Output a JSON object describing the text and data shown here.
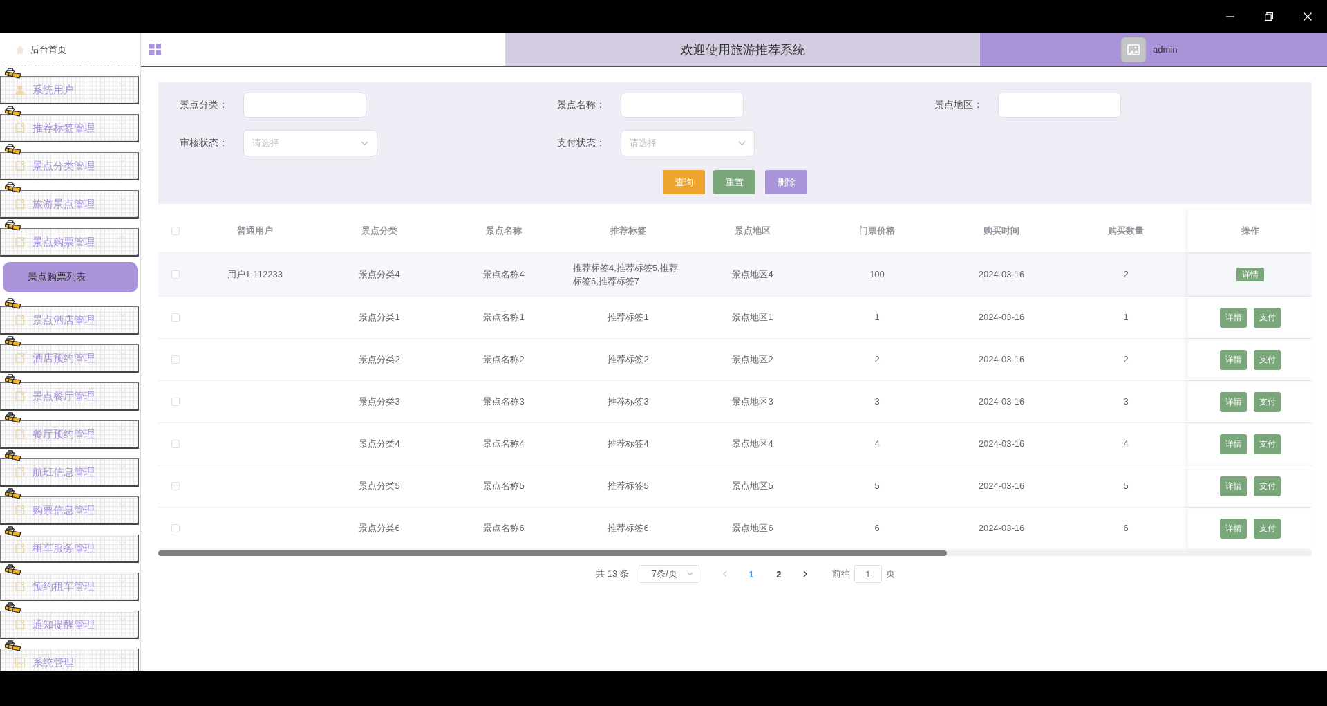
{
  "sidebar": {
    "home": {
      "label": "后台首页"
    },
    "items": [
      {
        "label": "系统用户",
        "kind": "user",
        "expanded": false
      },
      {
        "label": "推荐标签管理",
        "kind": "doc",
        "expanded": false
      },
      {
        "label": "景点分类管理",
        "kind": "doc",
        "expanded": false
      },
      {
        "label": "旅游景点管理",
        "kind": "doc",
        "expanded": false
      },
      {
        "label": "景点购票管理",
        "kind": "doc",
        "expanded": true,
        "children": [
          {
            "label": "景点购票列表",
            "selected": true
          }
        ]
      },
      {
        "label": "景点酒店管理",
        "kind": "doc",
        "expanded": false
      },
      {
        "label": "酒店预约管理",
        "kind": "doc",
        "expanded": false
      },
      {
        "label": "景点餐厅管理",
        "kind": "doc",
        "expanded": false
      },
      {
        "label": "餐厅预约管理",
        "kind": "doc",
        "expanded": false
      },
      {
        "label": "航班信息管理",
        "kind": "doc",
        "expanded": false
      },
      {
        "label": "购票信息管理",
        "kind": "doc",
        "expanded": false
      },
      {
        "label": "租车服务管理",
        "kind": "doc",
        "expanded": false
      },
      {
        "label": "预约租车管理",
        "kind": "doc",
        "expanded": false
      },
      {
        "label": "通知提醒管理",
        "kind": "doc",
        "expanded": false
      },
      {
        "label": "系统管理",
        "kind": "image",
        "expanded": false
      }
    ]
  },
  "header": {
    "title": "欢迎使用旅游推荐系统",
    "user": "admin"
  },
  "search": {
    "fields": [
      {
        "label": "景点分类：",
        "kind": "input"
      },
      {
        "label": "景点名称：",
        "kind": "input"
      },
      {
        "label": "景点地区：",
        "kind": "input"
      },
      {
        "label": "审核状态：",
        "kind": "select",
        "placeholder": "请选择"
      },
      {
        "label": "支付状态：",
        "kind": "select",
        "placeholder": "请选择"
      }
    ],
    "buttons": [
      {
        "label": "查询",
        "kind": "query"
      },
      {
        "label": "重置",
        "kind": "reset"
      },
      {
        "label": "删除",
        "kind": "delete"
      }
    ]
  },
  "table": {
    "all_checked": false,
    "columns": [
      "普通用户",
      "景点分类",
      "景点名称",
      "推荐标签",
      "景点地区",
      "门票价格",
      "购买时间",
      "购买数量"
    ],
    "action_column": "操作",
    "rows": [
      {
        "checked": false,
        "highlighted": true,
        "cells": [
          "用户1-112233",
          "景点分类4",
          "景点名称4",
          "推荐标签4,推荐标签5,推荐标签6,推荐标签7",
          "景点地区4",
          "100",
          "2024-03-16",
          "2"
        ],
        "actions": [
          "详情"
        ]
      },
      {
        "checked": false,
        "highlighted": false,
        "cells": [
          "",
          "景点分类1",
          "景点名称1",
          "推荐标签1",
          "景点地区1",
          "1",
          "2024-03-16",
          "1"
        ],
        "actions": [
          "详情",
          "支付"
        ]
      },
      {
        "checked": false,
        "highlighted": false,
        "cells": [
          "",
          "景点分类2",
          "景点名称2",
          "推荐标签2",
          "景点地区2",
          "2",
          "2024-03-16",
          "2"
        ],
        "actions": [
          "详情",
          "支付"
        ]
      },
      {
        "checked": false,
        "highlighted": false,
        "cells": [
          "",
          "景点分类3",
          "景点名称3",
          "推荐标签3",
          "景点地区3",
          "3",
          "2024-03-16",
          "3"
        ],
        "actions": [
          "详情",
          "支付"
        ]
      },
      {
        "checked": false,
        "highlighted": false,
        "cells": [
          "",
          "景点分类4",
          "景点名称4",
          "推荐标签4",
          "景点地区4",
          "4",
          "2024-03-16",
          "4"
        ],
        "actions": [
          "详情",
          "支付"
        ]
      },
      {
        "checked": false,
        "highlighted": false,
        "cells": [
          "",
          "景点分类5",
          "景点名称5",
          "推荐标签5",
          "景点地区5",
          "5",
          "2024-03-16",
          "5"
        ],
        "actions": [
          "详情",
          "支付"
        ]
      },
      {
        "checked": false,
        "highlighted": false,
        "cells": [
          "",
          "景点分类6",
          "景点名称6",
          "推荐标签6",
          "景点地区6",
          "6",
          "2024-03-16",
          "6"
        ],
        "actions": [
          "详情",
          "支付"
        ]
      }
    ]
  },
  "pagination": {
    "total": "共 13 条",
    "page_size": "7条/页",
    "pages": [
      {
        "label": "1",
        "selected": true
      },
      {
        "label": "2",
        "selected": false
      }
    ],
    "goto_label": "前往",
    "goto_value": "1",
    "goto_suffix": "页"
  }
}
